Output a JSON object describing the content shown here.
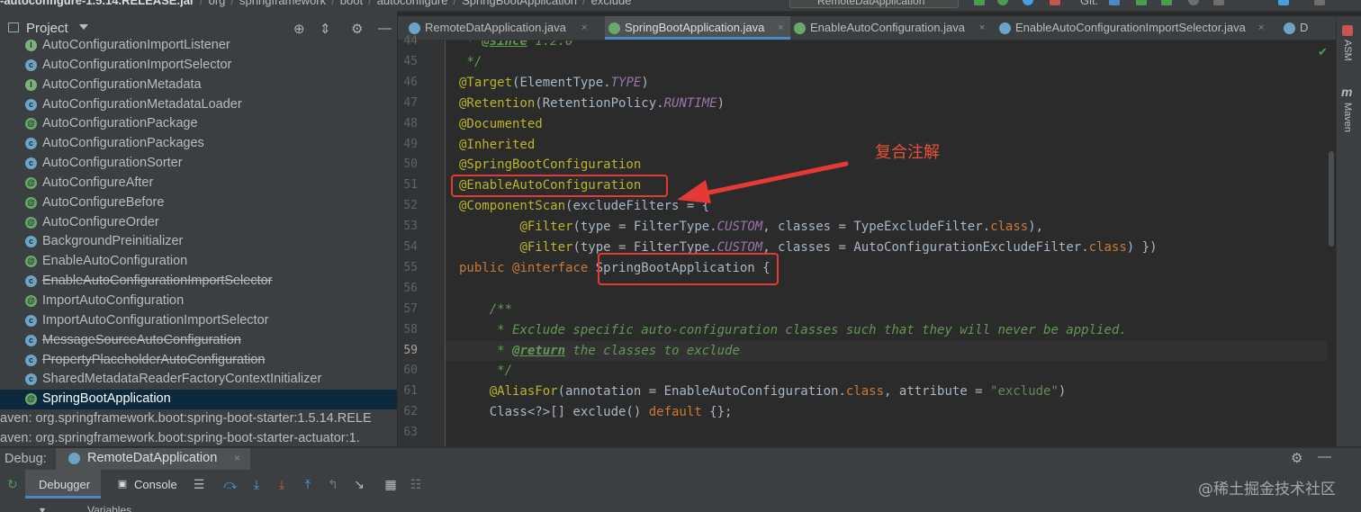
{
  "breadcrumb": {
    "items": [
      "-autoconfigure-1.5.14.RELEASE.jar",
      "org",
      "springframework",
      "boot",
      "autoconfigure",
      "SpringBootApplication",
      "exclude"
    ],
    "run_config": "RemoteDatApplication",
    "git_label": "Git:"
  },
  "project_panel": {
    "title": "Project",
    "tree": [
      {
        "label": "AutoConfigurationImportListener",
        "kind": "interface",
        "strike": false
      },
      {
        "label": "AutoConfigurationImportSelector",
        "kind": "class",
        "strike": false
      },
      {
        "label": "AutoConfigurationMetadata",
        "kind": "interface",
        "strike": false
      },
      {
        "label": "AutoConfigurationMetadataLoader",
        "kind": "class",
        "strike": false
      },
      {
        "label": "AutoConfigurationPackage",
        "kind": "annotation",
        "strike": false
      },
      {
        "label": "AutoConfigurationPackages",
        "kind": "class",
        "strike": false
      },
      {
        "label": "AutoConfigurationSorter",
        "kind": "class",
        "strike": false
      },
      {
        "label": "AutoConfigureAfter",
        "kind": "annotation",
        "strike": false
      },
      {
        "label": "AutoConfigureBefore",
        "kind": "annotation",
        "strike": false
      },
      {
        "label": "AutoConfigureOrder",
        "kind": "annotation",
        "strike": false
      },
      {
        "label": "BackgroundPreinitializer",
        "kind": "class",
        "strike": false
      },
      {
        "label": "EnableAutoConfiguration",
        "kind": "annotation",
        "strike": false
      },
      {
        "label": "EnableAutoConfigurationImportSelector",
        "kind": "class",
        "strike": true
      },
      {
        "label": "ImportAutoConfiguration",
        "kind": "annotation",
        "strike": false
      },
      {
        "label": "ImportAutoConfigurationImportSelector",
        "kind": "class",
        "strike": false
      },
      {
        "label": "MessageSourceAutoConfiguration",
        "kind": "class",
        "strike": true
      },
      {
        "label": "PropertyPlaceholderAutoConfiguration",
        "kind": "class",
        "strike": true
      },
      {
        "label": "SharedMetadataReaderFactoryContextInitializer",
        "kind": "class",
        "strike": false
      },
      {
        "label": "SpringBootApplication",
        "kind": "annotation",
        "strike": false,
        "selected": true
      }
    ],
    "libraries": [
      "aven: org.springframework.boot:spring-boot-starter:1.5.14.RELE",
      "aven: org.springframework.boot:spring-boot-starter-actuator:1."
    ]
  },
  "editor_tabs": [
    {
      "label": "RemoteDatApplication.java",
      "active": false
    },
    {
      "label": "SpringBootApplication.java",
      "active": true
    },
    {
      "label": "EnableAutoConfiguration.java",
      "active": false
    },
    {
      "label": "EnableAutoConfigurationImportSelector.java",
      "active": false
    },
    {
      "label": "D",
      "active": false
    }
  ],
  "code": {
    "line_numbers": [
      "44",
      "45",
      "46",
      "47",
      "48",
      "49",
      "50",
      "51",
      "52",
      "53",
      "54",
      "55",
      "56",
      "57",
      "58",
      "59",
      "60",
      "61",
      "62",
      "63"
    ],
    "current_line": "59",
    "lines": [
      [
        {
          "t": " * ",
          "c": "doc"
        },
        {
          "t": "@since",
          "c": "doctag"
        },
        {
          "t": " 1.2.0",
          "c": "doc"
        }
      ],
      [
        {
          "t": " */",
          "c": "doc"
        }
      ],
      [
        {
          "t": "@Target",
          "c": "ann"
        },
        {
          "t": "(ElementType.",
          "c": "plain"
        },
        {
          "t": "TYPE",
          "c": "ital"
        },
        {
          "t": ")",
          "c": "plain"
        }
      ],
      [
        {
          "t": "@Retention",
          "c": "ann"
        },
        {
          "t": "(RetentionPolicy.",
          "c": "plain"
        },
        {
          "t": "RUNTIME",
          "c": "ital"
        },
        {
          "t": ")",
          "c": "plain"
        }
      ],
      [
        {
          "t": "@Documented",
          "c": "ann"
        }
      ],
      [
        {
          "t": "@Inherited",
          "c": "ann"
        }
      ],
      [
        {
          "t": "@SpringBootConfiguration",
          "c": "ann"
        }
      ],
      [
        {
          "t": "@EnableAutoConfiguration",
          "c": "ann"
        }
      ],
      [
        {
          "t": "@ComponentScan",
          "c": "ann"
        },
        {
          "t": "(excludeFilters = {",
          "c": "plain"
        }
      ],
      [
        {
          "t": "        ",
          "c": "plain"
        },
        {
          "t": "@Filter",
          "c": "ann"
        },
        {
          "t": "(type = FilterType.",
          "c": "plain"
        },
        {
          "t": "CUSTOM",
          "c": "ital"
        },
        {
          "t": ", classes = TypeExcludeFilter.",
          "c": "plain"
        },
        {
          "t": "class",
          "c": "kw"
        },
        {
          "t": "),",
          "c": "plain"
        }
      ],
      [
        {
          "t": "        ",
          "c": "plain"
        },
        {
          "t": "@Filter",
          "c": "ann"
        },
        {
          "t": "(type = FilterType.",
          "c": "plain"
        },
        {
          "t": "CUSTOM",
          "c": "ital"
        },
        {
          "t": ", classes = AutoConfigurationExcludeFilter.",
          "c": "plain"
        },
        {
          "t": "class",
          "c": "kw"
        },
        {
          "t": ") })",
          "c": "plain"
        }
      ],
      [
        {
          "t": "public ",
          "c": "kw"
        },
        {
          "t": "@interface ",
          "c": "kw"
        },
        {
          "t": "SpringBootApplication {",
          "c": "plain"
        }
      ],
      [],
      [
        {
          "t": "    /**",
          "c": "doc"
        }
      ],
      [
        {
          "t": "     * Exclude specific auto-configuration classes such that they will never be applied.",
          "c": "doc"
        }
      ],
      [
        {
          "t": "     * ",
          "c": "doc"
        },
        {
          "t": "@return",
          "c": "doctag"
        },
        {
          "t": " the classes to exclude",
          "c": "doc"
        }
      ],
      [
        {
          "t": "     */",
          "c": "doc"
        }
      ],
      [
        {
          "t": "    ",
          "c": "plain"
        },
        {
          "t": "@AliasFor",
          "c": "ann"
        },
        {
          "t": "(annotation = EnableAutoConfiguration.",
          "c": "plain"
        },
        {
          "t": "class",
          "c": "kw"
        },
        {
          "t": ", attribute = ",
          "c": "plain"
        },
        {
          "t": "\"exclude\"",
          "c": "str"
        },
        {
          "t": ")",
          "c": "plain"
        }
      ],
      [
        {
          "t": "    Class<?>[] exclude() ",
          "c": "plain"
        },
        {
          "t": "default ",
          "c": "kw"
        },
        {
          "t": "{};",
          "c": "plain"
        }
      ],
      []
    ]
  },
  "annotation_note": "复合注解",
  "right_strip": {
    "asm": "ASM",
    "maven": "Maven"
  },
  "debug": {
    "label": "Debug:",
    "session_tab": "RemoteDatApplication",
    "debugger_tab": "Debugger",
    "console_tab": "Console",
    "variables_label": "Variables"
  },
  "watermark": "@稀土掘金技术社区",
  "colors": {
    "annotation": "#bbb529",
    "keyword": "#cc7832",
    "doc": "#629755",
    "highlight_box": "#e53935",
    "selection": "#0d293e"
  }
}
